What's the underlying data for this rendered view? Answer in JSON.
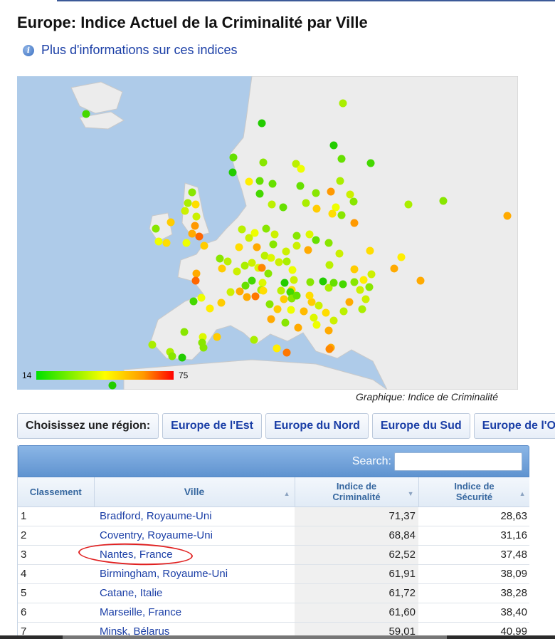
{
  "page": {
    "title": "Europe: Indice Actuel de la Criminalité par Ville",
    "info_link": "Plus d'informations sur ces indices",
    "info_icon": "info-icon"
  },
  "map": {
    "caption": "Graphique: Indice de Criminalité",
    "legend_min": "14",
    "legend_max": "75",
    "gradient_colors": [
      "#00e000",
      "#ffff00",
      "#ff9900",
      "#ff0000"
    ]
  },
  "regions": {
    "label": "Choisissez une région:",
    "buttons": [
      "Europe de l'Est",
      "Europe du Nord",
      "Europe du Sud",
      "Europe de l'Ou"
    ]
  },
  "search": {
    "label": "Search:",
    "value": ""
  },
  "table": {
    "headers": {
      "rank": "Classement",
      "city": "Ville",
      "crime_l1": "Indice de",
      "crime_l2": "Criminalité",
      "safety_l1": "Indice de",
      "safety_l2": "Sécurité"
    },
    "rows": [
      {
        "rank": "1",
        "city": "Bradford, Royaume-Uni",
        "crime": "71,37",
        "safety": "28,63"
      },
      {
        "rank": "2",
        "city": "Coventry, Royaume-Uni",
        "crime": "68,84",
        "safety": "31,16"
      },
      {
        "rank": "3",
        "city": "Nantes, France",
        "crime": "62,52",
        "safety": "37,48"
      },
      {
        "rank": "4",
        "city": "Birmingham, Royaume-Uni",
        "crime": "61,91",
        "safety": "38,09"
      },
      {
        "rank": "5",
        "city": "Catane, Italie",
        "crime": "61,72",
        "safety": "38,28"
      },
      {
        "rank": "6",
        "city": "Marseille, France",
        "crime": "61,60",
        "safety": "38,40"
      },
      {
        "rank": "7",
        "city": "Minsk, Bélarus",
        "crime": "59,01",
        "safety": "40,99"
      }
    ]
  },
  "colors": {
    "accent": "#5f93d0",
    "link": "#1a3ea6",
    "highlight_ring": "#e02020"
  }
}
